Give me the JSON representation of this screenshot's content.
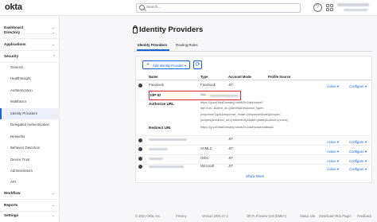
{
  "header": {
    "logo": "okta",
    "search_placeholder": "Search...",
    "help": "?"
  },
  "sidebar": {
    "sections": [
      {
        "label": "Dashboard",
        "chevron": "⌄"
      },
      {
        "label": "Directory",
        "chevron": "⌄"
      },
      {
        "label": "Applications",
        "chevron": "⌄"
      },
      {
        "label": "Security",
        "chevron": "^"
      }
    ],
    "items": [
      {
        "label": "General"
      },
      {
        "label": "HealthInsight"
      },
      {
        "label": "Authentication"
      },
      {
        "label": "Multifactor"
      },
      {
        "label": "Identity Providers"
      },
      {
        "label": "Delegated Authentication"
      },
      {
        "label": "Networks"
      },
      {
        "label": "Behavior Detection"
      },
      {
        "label": "Device Trust"
      },
      {
        "label": "Administrators"
      },
      {
        "label": "API"
      }
    ],
    "bottom_sections": [
      {
        "label": "Workflow",
        "chevron": "⌄"
      },
      {
        "label": "Reports",
        "chevron": "⌄"
      },
      {
        "label": "Settings",
        "chevron": "⌄"
      }
    ]
  },
  "page": {
    "title": "Identity Providers",
    "tabs": [
      "Identity Providers",
      "Routing Rules"
    ],
    "add_button": "Add Identity Provider ▾",
    "refresh_icon": "⟳"
  },
  "table": {
    "columns": [
      "Name",
      "Type",
      "Account Mode",
      "Profile Source"
    ],
    "expanded_row": {
      "name": "Facebook",
      "type": "Facebook",
      "account_mode": "JIT",
      "status": "Active ▾",
      "configure": "Configure ▾",
      "idp_id_label": "IdP ID",
      "idp_id_value": "0oa...",
      "authorize_url_label": "Authorize URL",
      "authorize_url_lines": [
        "https://{yourOktaDomain}/oauth2/v1/authorize?",
        "idp=0oa...&client_id={clientId}&response_type=",
        "{responseType}&response_mode={responseMode}&scope=",
        "{scopes}&redirect_uri={redirectUri}&state={state}&nonce={nonce}"
      ],
      "redirect_uri_label": "Redirect URI",
      "redirect_uri_value": "https://{yourOktaDomain}/oauth2/v1/authorize/callback"
    },
    "rows": [
      {
        "type": "",
        "account_mode": "JIT",
        "status": "Active ▾",
        "configure": "Configure ▾"
      },
      {
        "type": "SAML2",
        "account_mode": "JIT",
        "status": "Active ▾",
        "configure": "Configure ▾"
      },
      {
        "type": "OIDC",
        "account_mode": "JIT",
        "status": "Active ▾",
        "configure": "Configure ▾"
      },
      {
        "type": "Microsoft",
        "account_mode": "JIT",
        "status": "Active ▾",
        "configure": "Configure ▾"
      }
    ],
    "show_more": "Show More"
  },
  "footer": {
    "copyright": "© 2021 Okta, Inc.",
    "privacy": "Privacy",
    "version": "Version 2021.07.1",
    "cell": "OKTA Preview Cell (EMEA)",
    "status_site": "Status site",
    "download_plugin": "Download Okta Plugin",
    "feedback": "Feedback"
  }
}
